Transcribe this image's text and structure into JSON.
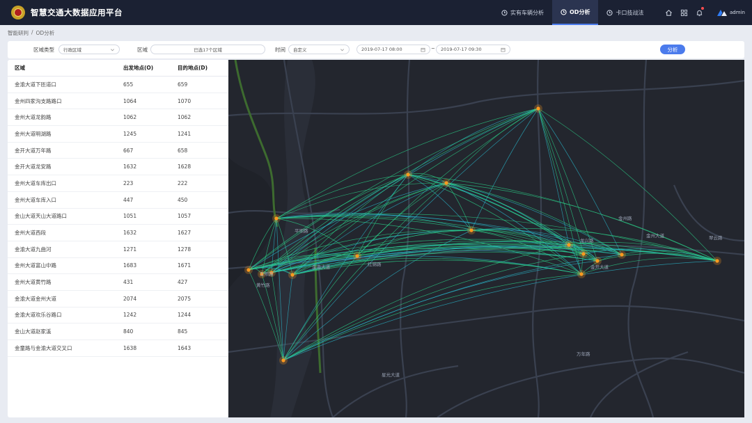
{
  "app": {
    "title": "智慧交通大数据应用平台"
  },
  "nav": {
    "tabs": [
      {
        "label": "实有车辆分析",
        "active": false
      },
      {
        "label": "OD分析",
        "active": true
      },
      {
        "label": "卡口技战法",
        "active": false
      }
    ],
    "user": "admin"
  },
  "breadcrumb": {
    "parent": "智能研判",
    "separator": "/",
    "current": "OD分析"
  },
  "filter": {
    "region_type_label": "区域类型",
    "region_type_value": "行政区域",
    "region_label": "区域",
    "region_value": "已选17个区域",
    "time_label": "时间",
    "time_value": "自定义",
    "start_time": "2019-07-17 08:00",
    "tilde": "~",
    "end_time": "2019-07-17 09:30",
    "analyze_label": "分析"
  },
  "table": {
    "headers": [
      "区域",
      "出发地点(O)",
      "目的地点(D)"
    ],
    "rows": [
      [
        "金渝大道下匝道口",
        "655",
        "659"
      ],
      [
        "金州四家沟支路路口",
        "1064",
        "1070"
      ],
      [
        "金州大道龙韵路",
        "1062",
        "1062"
      ],
      [
        "金州大道明湖路",
        "1245",
        "1241"
      ],
      [
        "金开大道万年路",
        "667",
        "658"
      ],
      [
        "金开大道龙安路",
        "1632",
        "1628"
      ],
      [
        "金州大道车库出口",
        "223",
        "222"
      ],
      [
        "金州大道车库入口",
        "447",
        "450"
      ],
      [
        "金山大道天山大道路口",
        "1051",
        "1057"
      ],
      [
        "金州大道西段",
        "1632",
        "1627"
      ],
      [
        "金渝大道九曲河",
        "1271",
        "1278"
      ],
      [
        "金州大道富山中路",
        "1683",
        "1671"
      ],
      [
        "金州大道黄竹路",
        "431",
        "427"
      ],
      [
        "金渝大道金州大道",
        "2074",
        "2075"
      ],
      [
        "金渝大道欢乐谷路口",
        "1242",
        "1244"
      ],
      [
        "金山大道赵家溪",
        "840",
        "845"
      ],
      [
        "金童路与金渝大道交叉口",
        "1638",
        "1643"
      ]
    ]
  },
  "map": {
    "colors": {
      "background": "#23262e",
      "road": "#3a4150",
      "flow": "#2bd18a",
      "flow_alt": "#2ab6c9",
      "node": "#ff9a1f"
    },
    "labels": [
      "平坝路",
      "金开大道",
      "黄竹路",
      "金州大道",
      "红锦路",
      "龙兴路",
      "星光大道",
      "万年路",
      "翠云路",
      "金渝大道",
      "五坝路",
      "金州路"
    ]
  }
}
